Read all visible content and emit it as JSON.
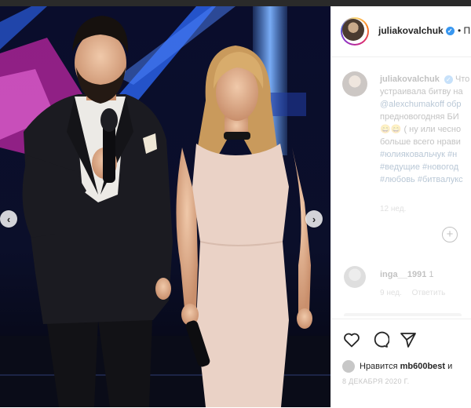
{
  "post": {
    "username": "juliakovalchuk",
    "header_suffix": "• П",
    "verified_mark": "✓"
  },
  "photo": {
    "nav_prev": "‹",
    "nav_next": "›",
    "colors": {
      "stage_blue": "#2e6bff",
      "stage_pink": "#ff2fd0",
      "dress": "#ead2c6",
      "suit": "#1a1a1e"
    }
  },
  "caption": {
    "username": "juliakovalchuk",
    "lines": [
      "Что",
      "устраивала битву на",
      "@alexchumakoff обр",
      "предновогодняя БИ",
      "😄😄 ( ну или чесно",
      "больше всего нрави",
      "#юлияковальчук #н",
      "#ведущие #новогод",
      "#любовь #битвалукс"
    ],
    "time": "12 нед."
  },
  "comment": {
    "username": "inga__1991",
    "text": "1",
    "time": "9 нед.",
    "reply": "Ответить"
  },
  "actions": {
    "icons": [
      "heart-icon",
      "comment-icon",
      "share-icon"
    ]
  },
  "likes": {
    "prefix": "Нравится",
    "user": "mb600best",
    "suffix": "и"
  },
  "date": "8 ДЕКАБРЯ 2020 Г."
}
